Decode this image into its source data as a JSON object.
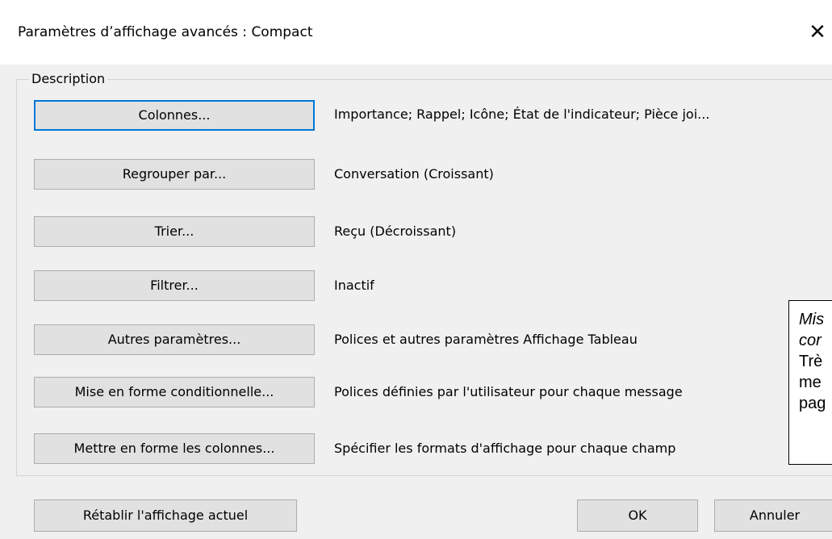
{
  "window": {
    "title": "Paramètres d’affichage avancés : Compact",
    "close_glyph": "✕"
  },
  "group": {
    "legend": "Description"
  },
  "rows": [
    {
      "button": "Colonnes...",
      "description": "Importance; Rappel; Icône; État de l'indicateur; Pièce joi..."
    },
    {
      "button": "Regrouper par...",
      "description": "Conversation (Croissant)"
    },
    {
      "button": "Trier...",
      "description": "Reçu (Décroissant)"
    },
    {
      "button": "Filtrer...",
      "description": "Inactif"
    },
    {
      "button": "Autres paramètres...",
      "description": "Polices et autres paramètres Affichage Tableau"
    },
    {
      "button": "Mise en forme conditionnelle...",
      "description": "Polices définies par l'utilisateur pour chaque message"
    },
    {
      "button": "Mettre en forme les colonnes...",
      "description": "Spécifier les formats d'affichage pour chaque champ"
    }
  ],
  "footer": {
    "reset_label": "Rétablir l'affichage actuel",
    "ok_label": "OK",
    "cancel_label": "Annuler"
  },
  "overlay_note": {
    "line1": "Mis",
    "line2": "cor",
    "line3": "Trè",
    "line4": "me",
    "line5": "pag"
  },
  "colors": {
    "focus_border": "#0078d7",
    "button_face": "#e1e1e1",
    "dialog_bg": "#f0f0f0"
  }
}
